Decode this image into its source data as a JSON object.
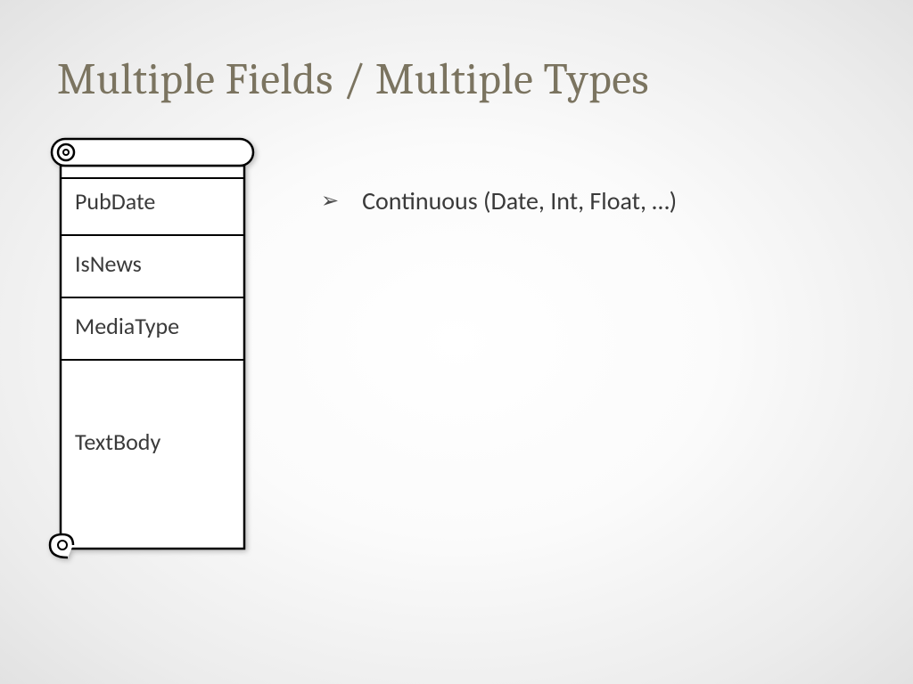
{
  "slide": {
    "title": "Multiple Fields / Multiple Types",
    "scroll_fields": {
      "0": "PubDate",
      "1": "IsNews",
      "2": "MediaType",
      "3": "TextBody"
    },
    "bullet": {
      "glyph": "➢",
      "text": "Continuous (Date, Int, Float, …)"
    }
  }
}
